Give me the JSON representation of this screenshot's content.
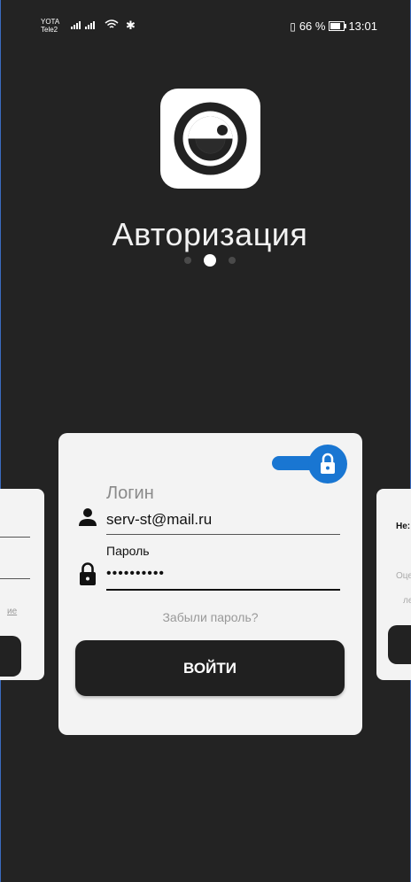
{
  "status_bar": {
    "carrier1": "YOTA",
    "carrier2": "Tele2",
    "battery_percent": "66 %",
    "time": "13:01"
  },
  "header": {
    "title": "Авторизация",
    "pager": {
      "count": 3,
      "active_index": 1
    }
  },
  "form": {
    "login_label": "Логин",
    "login_value": "serv-st@mail.ru",
    "password_label": "Пароль",
    "password_value": "••••••••••",
    "forgot_link": "Забыли пароль?",
    "submit_label": "ВОЙТИ",
    "lock_toggle_on": true
  },
  "side_cards": {
    "left_link": "ие",
    "right_title": "Не:",
    "right_line1": "Оце",
    "right_line2": "ле"
  },
  "colors": {
    "background": "#232323",
    "card": "#f3f3f3",
    "accent": "#1976d2",
    "button": "#202020"
  }
}
